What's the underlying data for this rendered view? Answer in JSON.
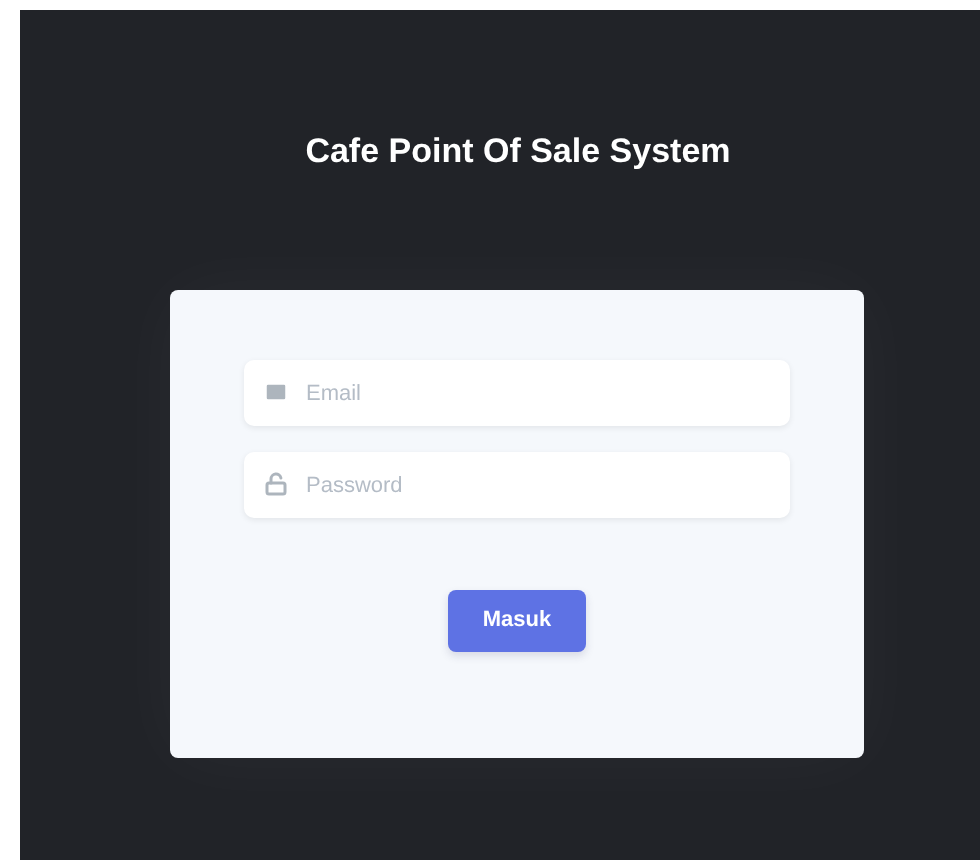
{
  "title": "Cafe Point Of Sale System",
  "form": {
    "fields": [
      {
        "kind": "email",
        "placeholder": "Email"
      },
      {
        "kind": "password",
        "placeholder": "Password"
      }
    ],
    "submit": "Masuk"
  }
}
